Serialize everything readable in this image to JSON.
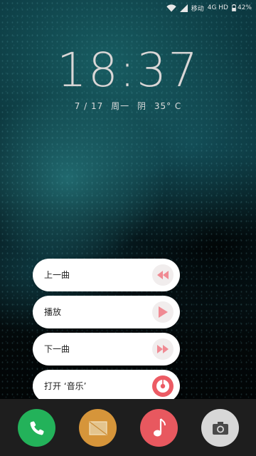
{
  "status_bar": {
    "carrier": "移动",
    "network": "4G HD",
    "battery": "42%",
    "icons": [
      "wifi-icon",
      "signal-icon",
      "battery-icon"
    ]
  },
  "lockscreen": {
    "time": "18:37",
    "date": "7 / 17",
    "weekday": "周一",
    "weather": "阴",
    "temperature": "35° C"
  },
  "music_menu": [
    {
      "label": "上一曲",
      "icon": "rewind-icon"
    },
    {
      "label": "播放",
      "icon": "play-icon"
    },
    {
      "label": "下一曲",
      "icon": "fast-forward-icon"
    },
    {
      "label": "打开 ‘音乐’",
      "icon": "music-app-icon"
    }
  ],
  "dock": [
    {
      "name": "phone",
      "icon": "phone-icon",
      "color": "#23b25a"
    },
    {
      "name": "messages",
      "icon": "message-icon",
      "color": "#d6953a"
    },
    {
      "name": "music",
      "icon": "music-note-icon",
      "color": "#e8585f"
    },
    {
      "name": "camera",
      "icon": "camera-icon",
      "color": "#d7d7d7"
    }
  ],
  "colors": {
    "accent_play": "#f08a93",
    "music_red": "#ec5b64"
  }
}
